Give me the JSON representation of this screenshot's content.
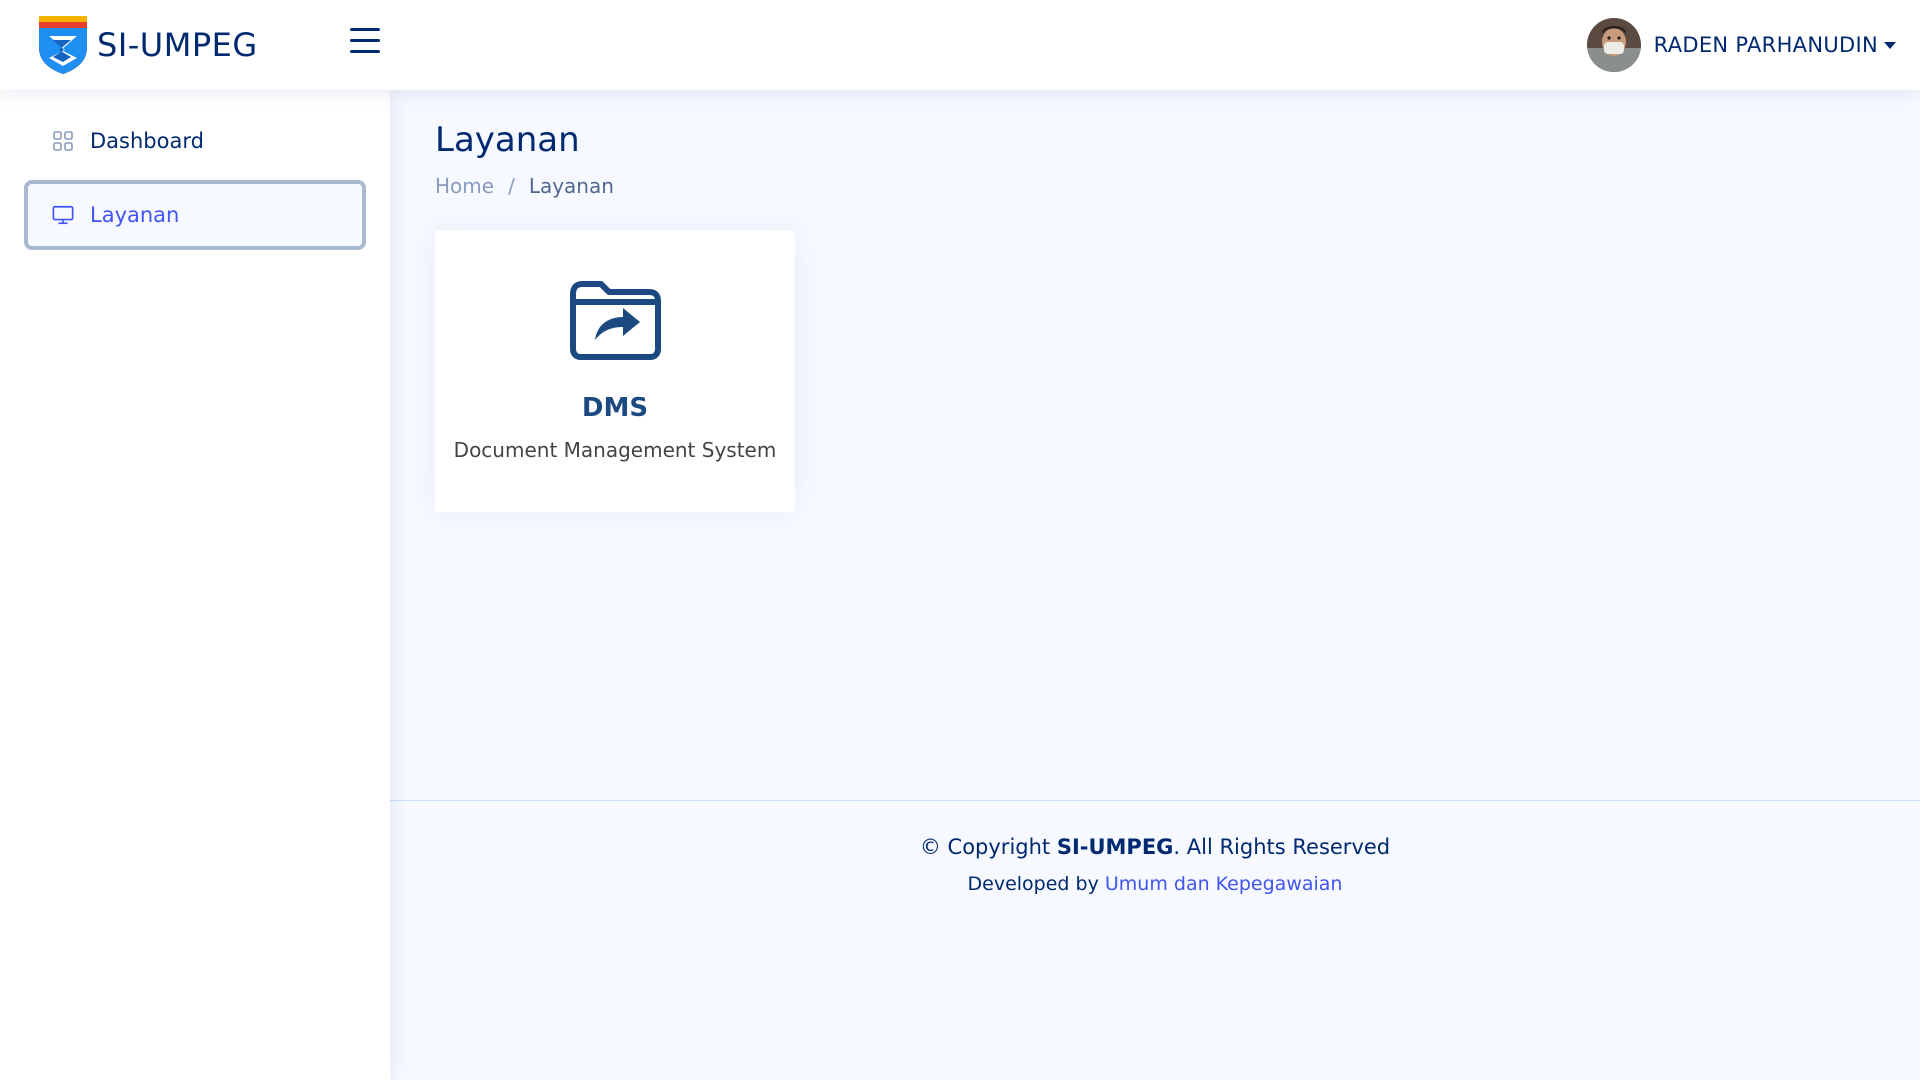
{
  "header": {
    "brand": "SI-UMPEG",
    "user_name": "RADEN PARHANUDIN",
    "icons": {
      "menu": "hamburger-menu-icon",
      "caret": "caret-down-icon"
    }
  },
  "sidebar": {
    "items": [
      {
        "label": "Dashboard",
        "icon": "grid-icon",
        "active": false
      },
      {
        "label": "Layanan",
        "icon": "monitor-icon",
        "active": true
      }
    ]
  },
  "main": {
    "title": "Layanan",
    "breadcrumb": [
      {
        "label": "Home"
      },
      {
        "label": "Layanan"
      }
    ],
    "breadcrumb_separator": "/",
    "cards": [
      {
        "title": "DMS",
        "subtitle": "Document Management System",
        "icon": "folder-share-icon"
      }
    ]
  },
  "footer": {
    "copyright_prefix": "© Copyright ",
    "copyright_brand": "SI-UMPEG",
    "copyright_suffix": ". All Rights Reserved",
    "developed_by": "Developed by ",
    "developer": "Umum dan Kepegawaian"
  },
  "colors": {
    "primary": "#012970",
    "accent": "#4154f1",
    "background": "#f6f9ff",
    "card_title": "#1c4a80"
  }
}
